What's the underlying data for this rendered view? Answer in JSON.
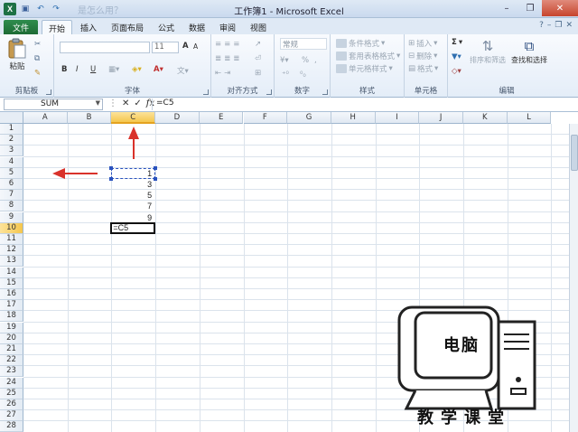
{
  "window": {
    "title": "工作簿1 - Microsoft Excel",
    "faded_overlay_text": "是怎么用？",
    "logo_letter": "X",
    "qat_icons": [
      "save-icon",
      "undo-icon",
      "redo-icon"
    ],
    "controls": [
      "minimize-icon",
      "restore-icon",
      "close-icon"
    ]
  },
  "tabs": [
    "文件",
    "开始",
    "插入",
    "页面布局",
    "公式",
    "数据",
    "审阅",
    "视图"
  ],
  "active_tab": "开始",
  "ribbon": {
    "clipboard": {
      "paste": "粘贴",
      "label": "剪贴板"
    },
    "font": {
      "font_name": "",
      "font_size": "11",
      "bold": "B",
      "italic": "I",
      "underline": "U",
      "grow": "A",
      "shrink": "A",
      "label": "字体"
    },
    "alignment": {
      "label": "对齐方式"
    },
    "number": {
      "format": "常规",
      "percent": "%",
      "comma": ",",
      "label": "数字"
    },
    "styles": {
      "conditional": "条件格式",
      "table": "套用表格格式",
      "cell": "单元格样式",
      "label": "样式"
    },
    "cells": {
      "insert": "插入",
      "delete": "删除",
      "format": "格式",
      "label": "单元格"
    },
    "editing": {
      "sum": "Σ",
      "sort": "排序和筛选",
      "find": "查找和选择",
      "label": "编辑"
    }
  },
  "formula_bar": {
    "name_box": "SUM",
    "cancel": "✕",
    "enter": "✓",
    "fx": "fx",
    "formula": "=C5"
  },
  "sheet": {
    "columns": [
      "A",
      "B",
      "C",
      "D",
      "E",
      "F",
      "G",
      "H",
      "I",
      "J",
      "K",
      "L"
    ],
    "selected_column": "C",
    "rows": [
      "1",
      "2",
      "3",
      "4",
      "5",
      "6",
      "7",
      "8",
      "9",
      "10",
      "11",
      "12",
      "13",
      "14",
      "15",
      "16",
      "17",
      "18",
      "19",
      "20",
      "21",
      "22",
      "23",
      "24",
      "25",
      "26",
      "27",
      "28"
    ],
    "selected_row": "10",
    "values": [
      {
        "row": 5,
        "col": "C",
        "value": "1"
      },
      {
        "row": 6,
        "col": "C",
        "value": "3"
      },
      {
        "row": 7,
        "col": "C",
        "value": "5"
      },
      {
        "row": 8,
        "col": "C",
        "value": "7"
      },
      {
        "row": 9,
        "col": "C",
        "value": "9"
      }
    ],
    "editing_cell": {
      "row": 10,
      "col": "C",
      "value": "=C5"
    },
    "reference_cell": {
      "row": 5,
      "col": "C"
    }
  },
  "annotations": {
    "arrow_color": "#d9322b"
  },
  "watermark": {
    "screen_text": "电脑",
    "caption": "教学课堂"
  },
  "colors": {
    "excel_green": "#1e7145",
    "selection_header": "#f5c64d",
    "reference_blue": "#2a52be"
  }
}
